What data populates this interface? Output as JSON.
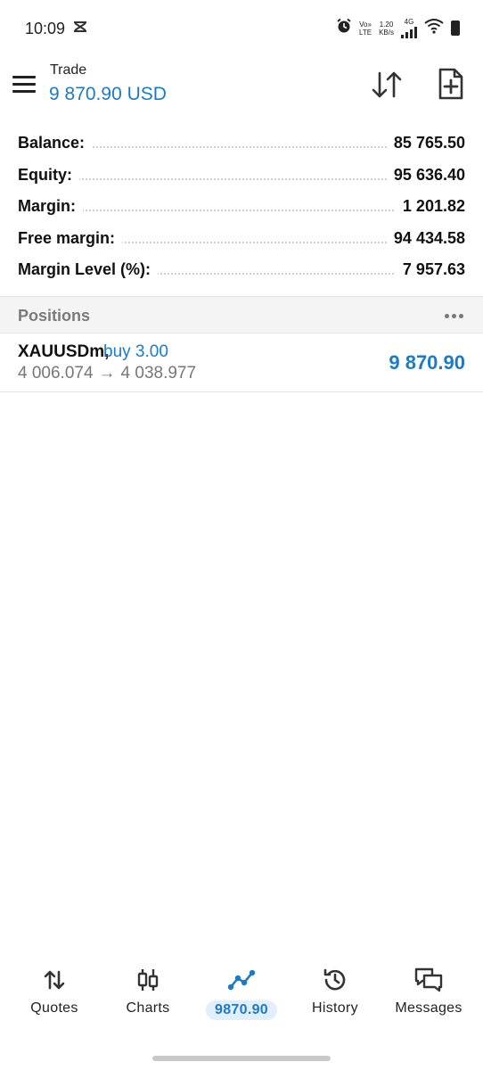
{
  "status_bar": {
    "time": "10:09",
    "volte_top": "Vo»",
    "volte_bottom": "LTE",
    "speed_top": "1.20",
    "speed_bottom": "KB/s",
    "network": "4G"
  },
  "header": {
    "title": "Trade",
    "subtitle": "9 870.90 USD"
  },
  "summary": [
    {
      "label": "Balance:",
      "value": "85 765.50"
    },
    {
      "label": "Equity:",
      "value": "95 636.40"
    },
    {
      "label": "Margin:",
      "value": "1 201.82"
    },
    {
      "label": "Free margin:",
      "value": "94 434.58"
    },
    {
      "label": "Margin Level (%):",
      "value": "7 957.63"
    }
  ],
  "positions": {
    "title": "Positions",
    "items": [
      {
        "symbol": "XAUUSDm,",
        "side": "buy 3.00",
        "open_price": "4 006.074",
        "arrow": "→",
        "current_price": "4 038.977",
        "profit": "9 870.90"
      }
    ]
  },
  "bottom_nav": [
    {
      "label": "Quotes",
      "icon": "quotes-arrows-icon"
    },
    {
      "label": "Charts",
      "icon": "candlestick-icon"
    },
    {
      "label": "9870.90",
      "icon": "trade-line-icon",
      "active": true
    },
    {
      "label": "History",
      "icon": "history-clock-icon"
    },
    {
      "label": "Messages",
      "icon": "chat-bubbles-icon"
    }
  ],
  "colors": {
    "accent": "#1a7bc8",
    "text": "#111111",
    "muted": "#777777",
    "section_bg": "#f4f4f4"
  }
}
